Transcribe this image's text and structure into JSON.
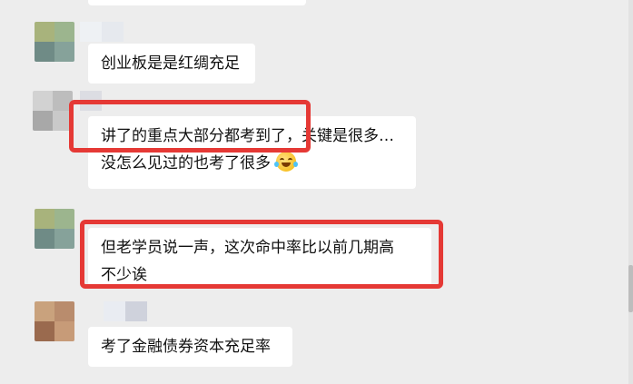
{
  "messages": [
    {
      "lines": [
        "创业板是是红绸充足"
      ]
    },
    {
      "lines": [
        "讲了的重点大部分都考到了，关键是很多…",
        "没怎么见过的也考了很多"
      ],
      "emoji": "laughing-crying-emoji"
    },
    {
      "lines": [
        "但老学员说一声，这次命中率比以前几期高",
        "不少诶"
      ]
    },
    {
      "lines": [
        "考了金融债券资本充足率"
      ]
    }
  ],
  "colors": {
    "background": "#ededed",
    "bubble": "#ffffff",
    "highlight": "#e53935",
    "text": "#111111"
  }
}
